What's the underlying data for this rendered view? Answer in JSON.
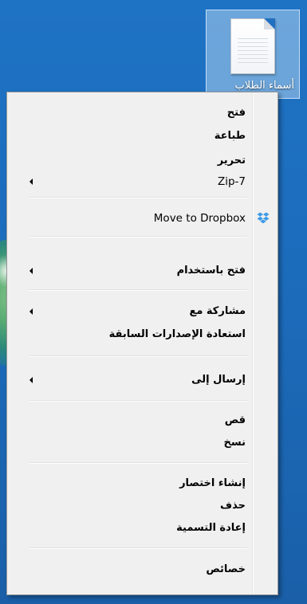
{
  "desktop": {
    "file_label": "أسماء الطلاب"
  },
  "menu": {
    "items": [
      {
        "label": "فتح"
      },
      {
        "label": "طباعة"
      },
      {
        "label": "تحرير"
      },
      {
        "label": "Zip-7"
      },
      {
        "label": "Move to Dropbox",
        "icon": "dropbox-icon"
      },
      {
        "label": "فتح باستخدام"
      },
      {
        "label": "مشاركة مع"
      },
      {
        "label": "استعادة الإصدارات السابقة"
      },
      {
        "label": "إرسال إلى"
      },
      {
        "label": "قص"
      },
      {
        "label": "نسخ"
      },
      {
        "label": "إنشاء اختصار"
      },
      {
        "label": "حذف"
      },
      {
        "label": "إعادة التسمية"
      },
      {
        "label": "خصائص"
      }
    ]
  },
  "colors": {
    "desktop_blue": "#1f73c4",
    "menu_background": "#f0f0f0",
    "dropbox_blue": "#3d9ae8"
  }
}
